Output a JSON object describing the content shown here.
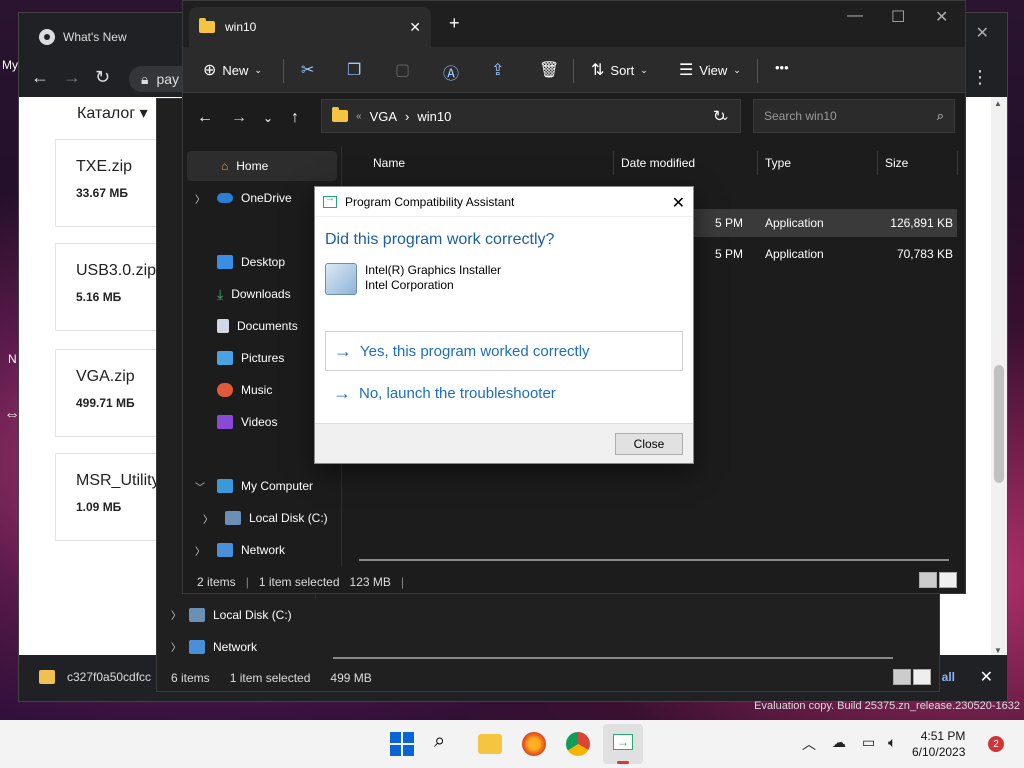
{
  "desktop": {
    "text_left_1": "My",
    "text_left_2": "N",
    "cursor": "⇔"
  },
  "chrome": {
    "tab_title": "What's New",
    "omnibox_text": "pay",
    "close_glyph": "✕",
    "catalog_label": "Каталог ▾",
    "files": [
      {
        "name": "TXE.zip",
        "size": "33.67 МБ"
      },
      {
        "name": "USB3.0.zip",
        "size": "5.16 МБ"
      },
      {
        "name": "VGA.zip",
        "size": "499.71 МБ"
      },
      {
        "name": "MSR_Utility",
        "size": "1.09 МБ"
      }
    ],
    "download": {
      "filename": "c327f0a50cdfcc",
      "show_all": "all"
    }
  },
  "explorer_back": {
    "nav": [
      {
        "label": "Local Disk (C:)"
      },
      {
        "label": "Network"
      }
    ],
    "status": {
      "items": "6 items",
      "selected": "1 item selected",
      "size": "499 MB"
    }
  },
  "explorer": {
    "tab_title": "win10",
    "commands": {
      "new": "New",
      "sort": "Sort",
      "view": "View",
      "more": "•••"
    },
    "address": {
      "parent": "VGA",
      "current": "win10"
    },
    "search_placeholder": "Search win10",
    "nav": [
      {
        "label": "Home"
      },
      {
        "label": "OneDrive"
      },
      {
        "label": "Desktop"
      },
      {
        "label": "Downloads"
      },
      {
        "label": "Documents"
      },
      {
        "label": "Pictures"
      },
      {
        "label": "Music"
      },
      {
        "label": "Videos"
      },
      {
        "label": "My Computer"
      },
      {
        "label": "Local Disk (C:)"
      },
      {
        "label": "Network"
      }
    ],
    "columns": {
      "name": "Name",
      "date": "Date modified",
      "type": "Type",
      "size": "Size"
    },
    "rows": [
      {
        "date": "5 PM",
        "type": "Application",
        "size": "126,891 KB"
      },
      {
        "date": "5 PM",
        "type": "Application",
        "size": "70,783 KB"
      }
    ],
    "status": {
      "items": "2 items",
      "selected": "1 item selected",
      "size": "123 MB"
    }
  },
  "dialog": {
    "title": "Program Compatibility Assistant",
    "question": "Did this program work correctly?",
    "program_name": "Intel(R) Graphics Installer",
    "publisher": "Intel Corporation",
    "option_yes": "Yes, this program worked correctly",
    "option_no": "No, launch the troubleshooter",
    "close_button": "Close"
  },
  "watermark": "Evaluation copy. Build 25375.zn_release.230520-1632",
  "taskbar": {
    "time": "4:51 PM",
    "date": "6/10/2023",
    "notifications": "2"
  },
  "colors": {
    "accent": "#1b6ec2",
    "dialog_heading": "#1b5fa8",
    "folder": "#f5c542"
  }
}
